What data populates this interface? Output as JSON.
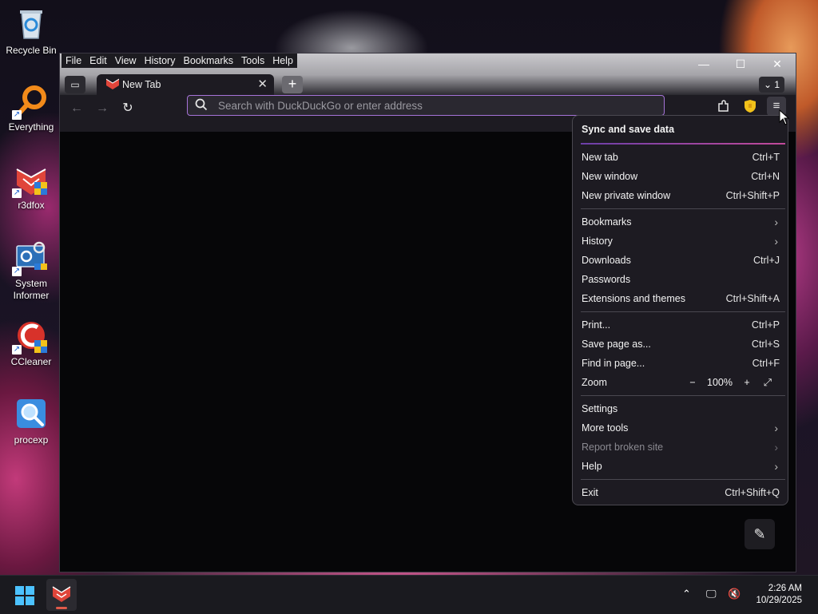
{
  "desktop": {
    "icons": [
      {
        "label": "Recycle Bin",
        "icon": "recycle-bin-icon"
      },
      {
        "label": "Everything",
        "icon": "everything-search-icon"
      },
      {
        "label": "r3dfox",
        "icon": "r3dfox-icon"
      },
      {
        "label": "System Informer",
        "icon": "system-informer-icon"
      },
      {
        "label": "CCleaner",
        "icon": "ccleaner-icon"
      },
      {
        "label": "procexp",
        "icon": "procexp-icon"
      }
    ]
  },
  "browser": {
    "menubar": [
      "File",
      "Edit",
      "View",
      "History",
      "Bookmarks",
      "Tools",
      "Help"
    ],
    "tab": {
      "title": "New Tab"
    },
    "all_tabs_count": "1",
    "urlbar": {
      "placeholder": "Search with DuckDuckGo or enter address"
    },
    "accent_color": "#a673d8"
  },
  "app_menu": {
    "header": "Sync and save data",
    "group1": [
      {
        "label": "New tab",
        "shortcut": "Ctrl+T"
      },
      {
        "label": "New window",
        "shortcut": "Ctrl+N"
      },
      {
        "label": "New private window",
        "shortcut": "Ctrl+Shift+P"
      }
    ],
    "group2": [
      {
        "label": "Bookmarks",
        "shortcut": ""
      },
      {
        "label": "History",
        "shortcut": ""
      },
      {
        "label": "Downloads",
        "shortcut": "Ctrl+J"
      },
      {
        "label": "Passwords",
        "shortcut": ""
      },
      {
        "label": "Extensions and themes",
        "shortcut": "Ctrl+Shift+A"
      }
    ],
    "group3": [
      {
        "label": "Print...",
        "shortcut": "Ctrl+P"
      },
      {
        "label": "Save page as...",
        "shortcut": "Ctrl+S"
      },
      {
        "label": "Find in page...",
        "shortcut": "Ctrl+F"
      }
    ],
    "zoom": {
      "label": "Zoom",
      "minus": "−",
      "value": "100%",
      "plus": "+"
    },
    "group4": [
      {
        "label": "Settings"
      },
      {
        "label": "More tools"
      },
      {
        "label": "Report broken site"
      },
      {
        "label": "Help"
      }
    ],
    "exit": {
      "label": "Exit",
      "shortcut": "Ctrl+Shift+Q"
    }
  },
  "taskbar": {
    "time": "2:26 AM",
    "date": "10/29/2025"
  }
}
